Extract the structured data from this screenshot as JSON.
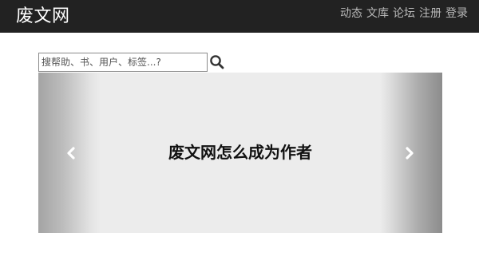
{
  "navbar": {
    "brand": "废文网",
    "links": [
      {
        "label": "动态"
      },
      {
        "label": "文库"
      },
      {
        "label": "论坛"
      },
      {
        "label": "注册"
      },
      {
        "label": "登录"
      }
    ]
  },
  "search": {
    "placeholder": "搜帮助、书、用户、标签...?"
  },
  "carousel": {
    "caption": "废文网怎么成为作者"
  },
  "colors": {
    "navbar_bg": "#222222",
    "nav_link": "#b8b8b8",
    "brand_text": "#ffffff",
    "carousel_bg": "#ececec"
  },
  "icons": [
    "search-icon",
    "chevron-left-icon",
    "chevron-right-icon"
  ]
}
